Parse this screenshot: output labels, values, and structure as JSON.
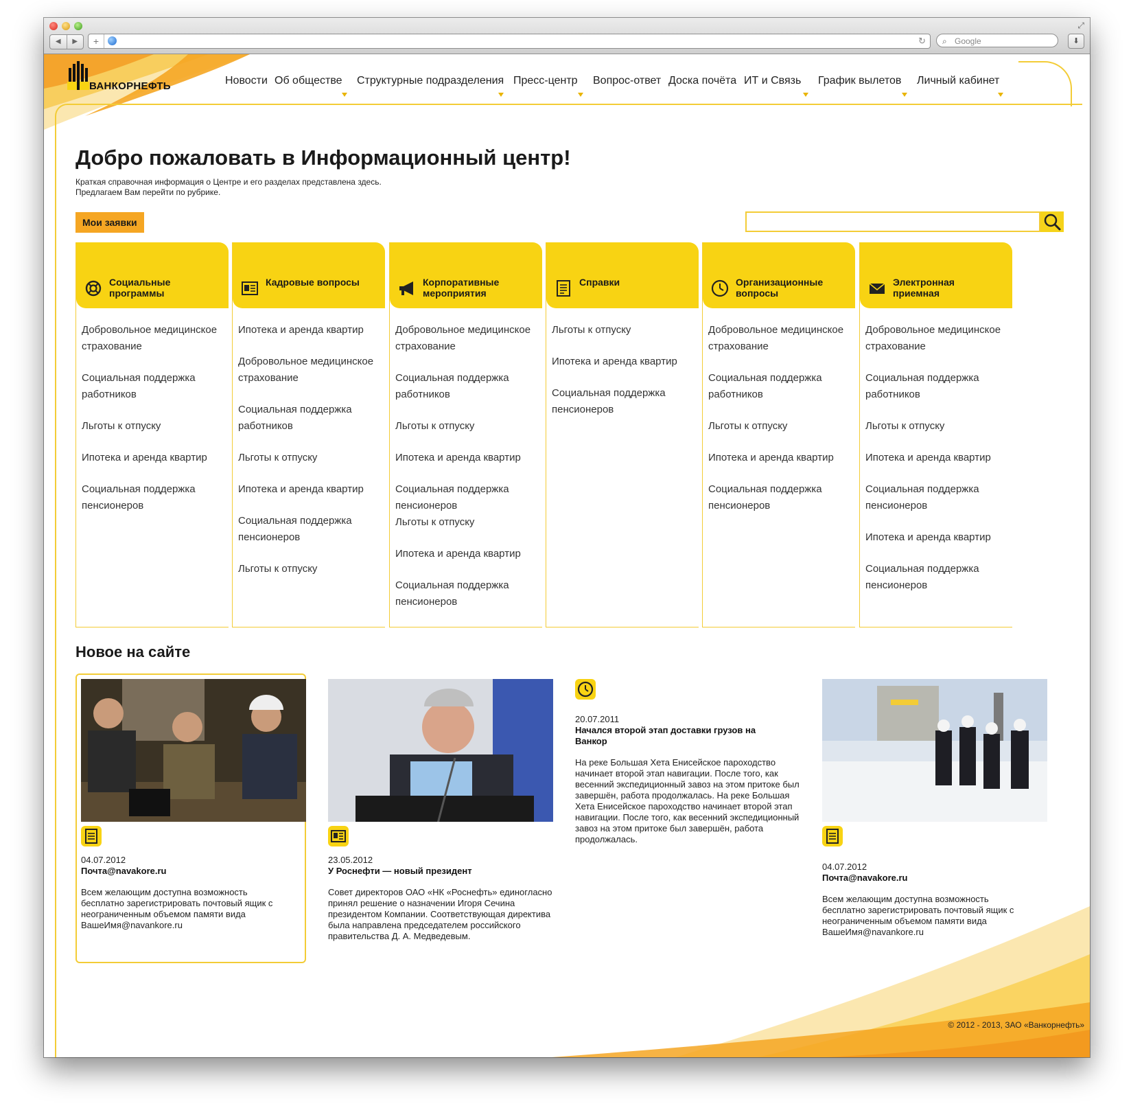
{
  "browser": {
    "search_placeholder": "Google"
  },
  "logo": {
    "text": "ВАНКОРНЕФТЬ"
  },
  "nav": [
    {
      "label": "Новости",
      "dropdown": false
    },
    {
      "label": "Об обществе",
      "dropdown": true
    },
    {
      "label": "Структурные подразделения",
      "dropdown": true
    },
    {
      "label": "Пресс-центр",
      "dropdown": true
    },
    {
      "label": "Вопрос-ответ",
      "dropdown": false
    },
    {
      "label": "Доска почёта",
      "dropdown": false
    },
    {
      "label": "ИТ и Связь",
      "dropdown": true
    },
    {
      "label": "График вылетов",
      "dropdown": true
    },
    {
      "label": "Личный кабинет",
      "dropdown": true
    }
  ],
  "welcome": {
    "title": "Добро пожаловать в Информационный центр!",
    "line1": "Краткая справочная информация о Центре и его разделах представлена здесь.",
    "line2": "Предлагаем Вам перейти по рубрике."
  },
  "my_requests_label": "Мои заявки",
  "search": {
    "value": ""
  },
  "categories": [
    {
      "title": "Социальные программы",
      "icon": "lifebuoy-icon",
      "items": [
        "Добровольное медицинское страхование",
        "Социальная поддержка работников",
        "Льготы к отпуску",
        "Ипотека и аренда квартир",
        "Социальная поддержка пенсионеров"
      ]
    },
    {
      "title": "Кадровые вопросы",
      "icon": "id-card-icon",
      "items": [
        "Ипотека и аренда квартир",
        "Добровольное медицинское страхование",
        "Социальная поддержка работников",
        "Льготы к отпуску",
        "Ипотека и аренда квартир",
        "Социальная поддержка пенсионеров",
        "Льготы к отпуску"
      ]
    },
    {
      "title": "Корпоративные мероприятия",
      "icon": "megaphone-icon",
      "items": [
        "Добровольное медицинское страхование",
        "Социальная поддержка работников",
        "Льготы к отпуску",
        "Ипотека и аренда квартир",
        "Социальная поддержка пенсионеров",
        "Льготы к отпуску",
        "Ипотека и аренда квартир",
        "Социальная поддержка пенсионеров"
      ]
    },
    {
      "title": "Справки",
      "icon": "document-icon",
      "items": [
        "Льготы к отпуску",
        "Ипотека и аренда квартир",
        "Социальная поддержка пенсионеров"
      ]
    },
    {
      "title": "Организационные вопросы",
      "icon": "clock-icon",
      "items": [
        "Добровольное медицинское страхование",
        "Социальная поддержка работников",
        "Льготы к отпуску",
        "Ипотека и аренда квартир",
        "Социальная поддержка пенсионеров"
      ]
    },
    {
      "title": "Электронная приемная",
      "icon": "envelope-icon",
      "items": [
        "Добровольное медицинское страхование",
        "Социальная поддержка работников",
        "Льготы к отпуску",
        "Ипотека и аренда квартир",
        "Социальная поддержка пенсионеров",
        "Ипотека и аренда квартир",
        "Социальная поддержка пенсионеров"
      ]
    }
  ],
  "news_section_title": "Новое на сайте",
  "news": [
    {
      "date": "04.07.2012",
      "headline": "Почта@navakore.ru",
      "text": "Всем желающим доступна возможность бесплатно зарегистрировать почтовый ящик с неограниченным объемом памяти вида ВашеИмя@navankore.ru",
      "icon": "document-icon"
    },
    {
      "date": "23.05.2012",
      "headline": "У Роснефти — новый президент",
      "text": "Совет директоров ОАО «НК «Роснефть» единогласно принял решение о назначении Игоря Сечина президентом Компании. Соответствующая директива была направлена председателем российского правительства Д. А. Медведевым.",
      "icon": "id-card-icon"
    },
    {
      "date": "20.07.2011",
      "headline": "Начался второй этап доставки грузов на Ванкор",
      "text": "На реке Большая Хета Енисейское пароходство начинает второй этап навигации. После того, как весенний экспедиционный завоз на этом притоке был завершён, работа продолжалась. На реке Большая Хета Енисейское пароходство начинает второй этап навигации. После того, как весенний экспедиционный завоз на этом притоке был завершён, работа продолжалась.",
      "icon": "clock-icon"
    },
    {
      "date": "04.07.2012",
      "headline": "Почта@navakore.ru",
      "text": "Всем желающим доступна возможность бесплатно зарегистрировать почтовый ящик с неограниченным объемом памяти вида ВашеИмя@navankore.ru",
      "icon": "document-icon"
    }
  ],
  "footer": "© 2012 - 2013, ЗАО «Ванкорнефть»",
  "colors": {
    "accent": "#f8d313",
    "orange": "#f5a623",
    "border": "#f3cc36"
  }
}
